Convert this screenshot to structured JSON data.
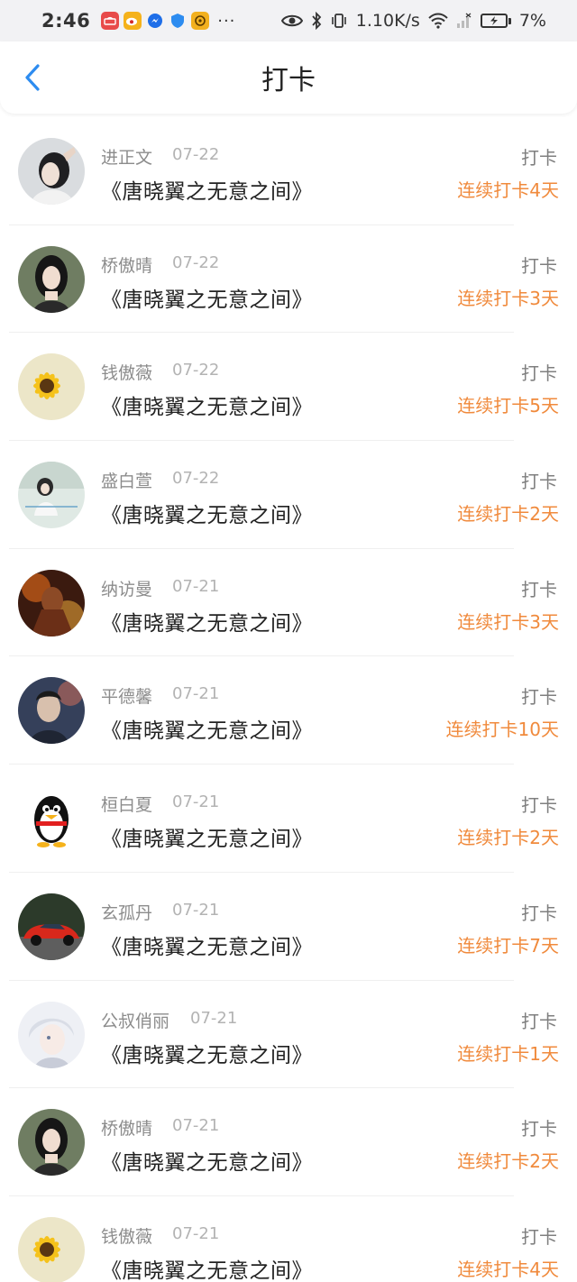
{
  "status_bar": {
    "time": "2:46",
    "network_speed": "1.10K/s",
    "battery": "7%",
    "dots": "···"
  },
  "nav": {
    "title": "打卡"
  },
  "records": [
    {
      "name": "进正文",
      "date": "07-22",
      "book": "《唐晓翼之无意之间》",
      "action": "打卡",
      "streak": "连续打卡4天",
      "avatar": "girl-hand-photo"
    },
    {
      "name": "桥傲晴",
      "date": "07-22",
      "book": "《唐晓翼之无意之间》",
      "action": "打卡",
      "streak": "连续打卡3天",
      "avatar": "girl-portrait-photo"
    },
    {
      "name": "钱傲薇",
      "date": "07-22",
      "book": "《唐晓翼之无意之间》",
      "action": "打卡",
      "streak": "连续打卡5天",
      "avatar": "sunflower-photo"
    },
    {
      "name": "盛白萱",
      "date": "07-22",
      "book": "《唐晓翼之无意之间》",
      "action": "打卡",
      "streak": "连续打卡2天",
      "avatar": "girl-sitting-photo"
    },
    {
      "name": "纳访曼",
      "date": "07-21",
      "book": "《唐晓翼之无意之间》",
      "action": "打卡",
      "streak": "连续打卡3天",
      "avatar": "game-hero-art"
    },
    {
      "name": "平德馨",
      "date": "07-21",
      "book": "《唐晓翼之无意之间》",
      "action": "打卡",
      "streak": "连续打卡10天",
      "avatar": "man-portrait-art"
    },
    {
      "name": "桓白夏",
      "date": "07-21",
      "book": "《唐晓翼之无意之间》",
      "action": "打卡",
      "streak": "连续打卡2天",
      "avatar": "penguin-icon"
    },
    {
      "name": "玄孤丹",
      "date": "07-21",
      "book": "《唐晓翼之无意之间》",
      "action": "打卡",
      "streak": "连续打卡7天",
      "avatar": "red-car-photo"
    },
    {
      "name": "公叔俏丽",
      "date": "07-21",
      "book": "《唐晓翼之无意之间》",
      "action": "打卡",
      "streak": "连续打卡1天",
      "avatar": "anime-boy-art"
    },
    {
      "name": "桥傲晴",
      "date": "07-21",
      "book": "《唐晓翼之无意之间》",
      "action": "打卡",
      "streak": "连续打卡2天",
      "avatar": "girl-portrait-photo"
    },
    {
      "name": "钱傲薇",
      "date": "07-21",
      "book": "《唐晓翼之无意之间》",
      "action": "打卡",
      "streak": "连续打卡4天",
      "avatar": "sunflower-photo"
    }
  ],
  "colors": {
    "accent_blue": "#2d8cf0",
    "streak_orange": "#f08a3c",
    "title_text": "#222222",
    "meta_text": "#8c8c8c"
  }
}
